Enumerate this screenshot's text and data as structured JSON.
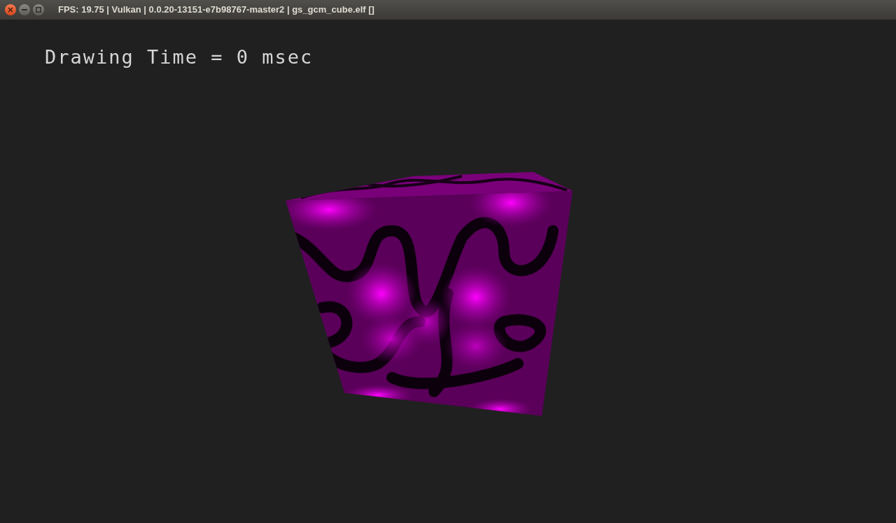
{
  "window": {
    "title": "FPS: 19.75 | Vulkan | 0.0.20-13151-e7b98767-master2 | gs_gcm_cube.elf []"
  },
  "overlay": {
    "text": "Drawing Time = 0 msec"
  }
}
